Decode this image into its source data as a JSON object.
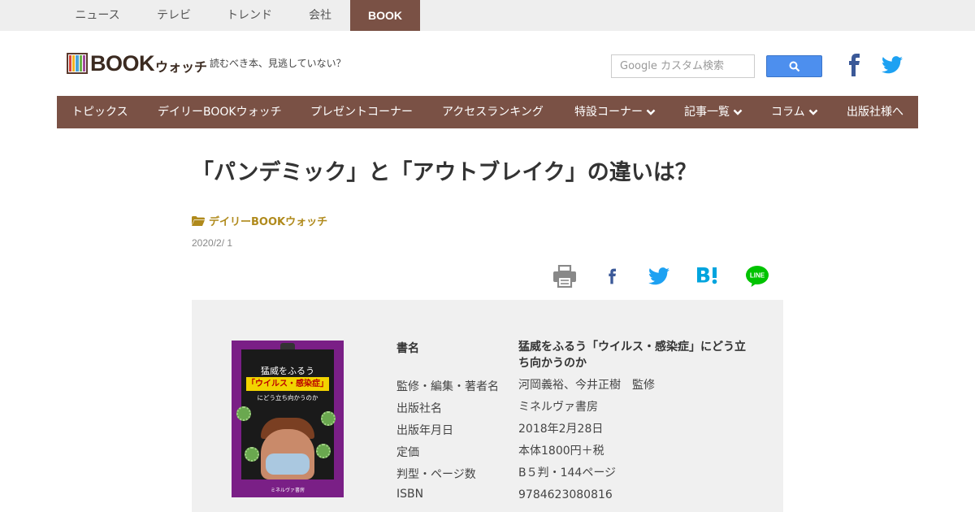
{
  "topnav": {
    "tabs": [
      "ニュース",
      "テレビ",
      "トレンド",
      "会社",
      "BOOK"
    ],
    "active": "BOOK"
  },
  "header": {
    "logo_main": "BOOK",
    "logo_sub": "ウォッチ",
    "tagline": "読むべき本、見逃していない？",
    "search_placeholder": "Google カスタム検索"
  },
  "mainnav": {
    "items": [
      "トピックス",
      "デイリーBOOKウォッチ",
      "プレゼントコーナー",
      "アクセスランキング",
      "特設コーナー",
      "記事一覧",
      "コラム",
      "出版社様へ"
    ]
  },
  "article": {
    "title": "「パンデミック」と「アウトブレイク」の違いは？",
    "category": "デイリーBOOKウォッチ",
    "date": "2020/2/ 1"
  },
  "share": [
    "print-icon",
    "facebook-icon",
    "twitter-icon",
    "hatena-bookmark-icon",
    "line-icon"
  ],
  "book": {
    "cover_title_line1": "猛威をふるう",
    "cover_title_line2": "「ウイルス・感染症」",
    "cover_title_line3": "にどう立ち向かうのか",
    "cover_publisher": "ミネルヴァ書房",
    "rows": [
      {
        "label": "書名",
        "value": "猛威をふるう「ウイルス・感染症」にどう立ち向かうのか"
      },
      {
        "label": "監修・編集・著者名",
        "value": "河岡義裕、今井正樹　監修"
      },
      {
        "label": "出版社名",
        "value": "ミネルヴァ書房"
      },
      {
        "label": "出版年月日",
        "value": "2018年2月28日"
      },
      {
        "label": "定価",
        "value": "本体1800円＋税"
      },
      {
        "label": "判型・ページ数",
        "value": "B５判・144ページ"
      },
      {
        "label": "ISBN",
        "value": "9784623080816"
      }
    ]
  },
  "colors": {
    "brand_brown": "#7a5145",
    "category_gold": "#b08a1c",
    "search_blue": "#4d8fee",
    "facebook": "#3b5998",
    "twitter": "#1da1f2",
    "hatena": "#00a4de",
    "line": "#00c300"
  }
}
